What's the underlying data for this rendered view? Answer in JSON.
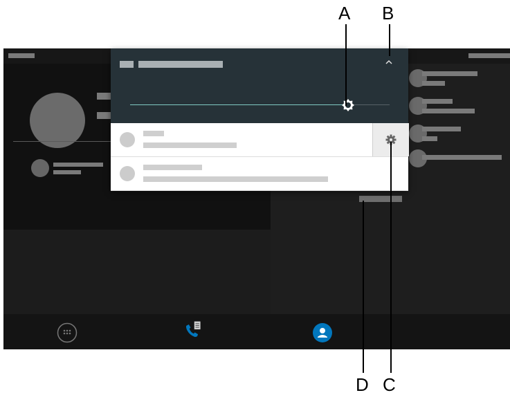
{
  "callouts": {
    "a": "A",
    "b": "B",
    "c": "C",
    "d": "D"
  },
  "brightness": {
    "level": 0.84
  },
  "colors": {
    "panel_header": "#263238",
    "slider_accent": "#80cbc4",
    "screen_background": "#1c1c1c",
    "contact_accent": "#0277bd"
  },
  "icons": {
    "collapse": "chevron-up-icon",
    "brightness": "brightness-icon",
    "settings": "gear-icon",
    "dialpad": "dialpad-icon",
    "call_log": "phone-list-icon",
    "contacts": "contacts-icon"
  }
}
